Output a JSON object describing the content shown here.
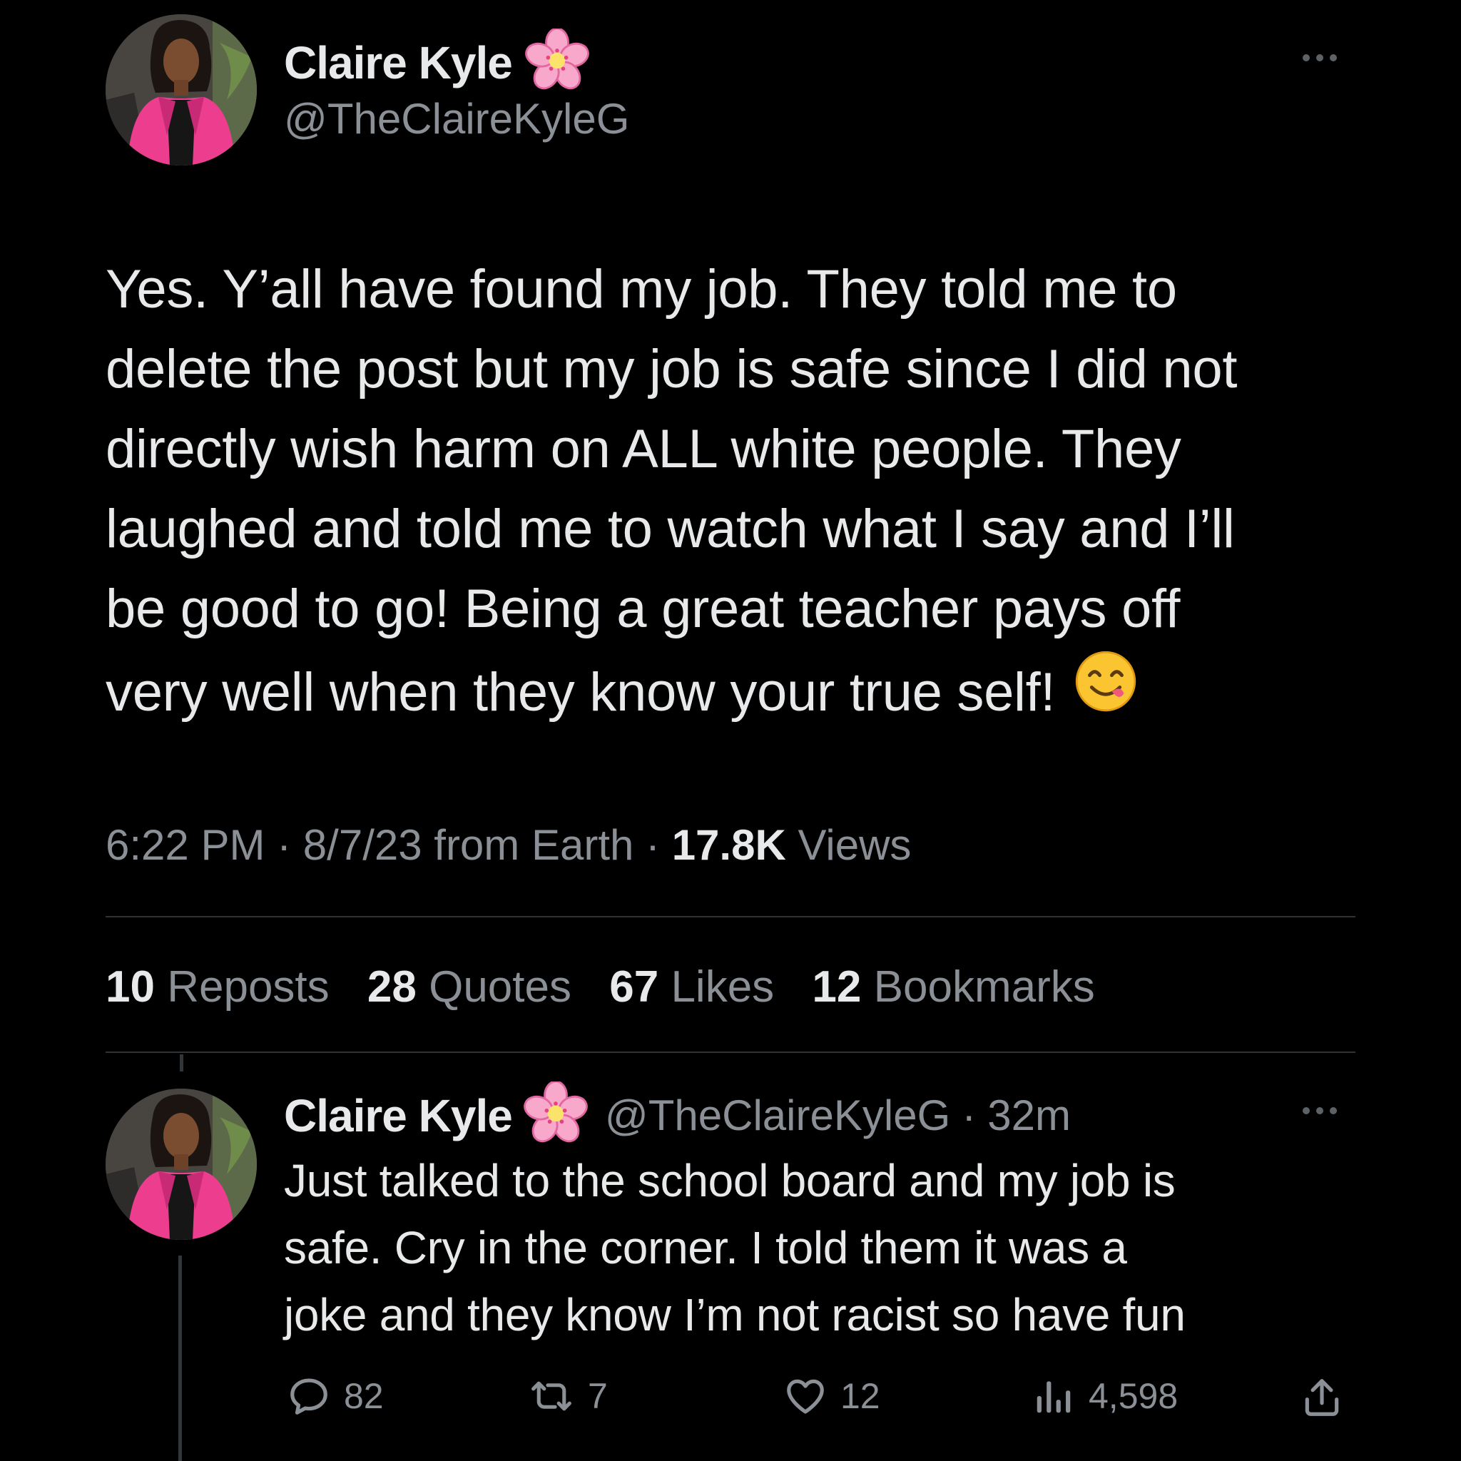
{
  "main_tweet": {
    "author": {
      "display_name": "Claire Kyle",
      "handle": "@TheClaireKyleG",
      "badge_icon": "cherry-blossom-icon"
    },
    "text_lines": [
      "Yes. Y’all have found my job. They told me to",
      "delete the post but my job is safe since I did not",
      "directly wish harm on ALL white people. They",
      "laughed and told me to watch what I say and I’ll",
      "be good to go! Being a great teacher pays off",
      "very well when they know your true self!"
    ],
    "trailing_emoji": "yum-face-icon",
    "time": "6:22 PM",
    "date": "8/7/23",
    "source": "from Earth",
    "separator": "·",
    "views_count": "17.8K",
    "views_label": "Views",
    "stats": {
      "reposts": {
        "count": "10",
        "label": "Reposts"
      },
      "quotes": {
        "count": "28",
        "label": "Quotes"
      },
      "likes": {
        "count": "67",
        "label": "Likes"
      },
      "bookmarks": {
        "count": "12",
        "label": "Bookmarks"
      }
    }
  },
  "reply": {
    "author": {
      "display_name": "Claire Kyle",
      "handle": "@TheClaireKyleG",
      "badge_icon": "cherry-blossom-icon"
    },
    "separator": "·",
    "age": "32m",
    "text_lines": [
      "Just talked to the school board and my job is",
      "safe. Cry in the corner. I told them it was a",
      "joke and they know I’m not racist so have fun"
    ],
    "actions": {
      "replies": "82",
      "reposts": "7",
      "likes": "12",
      "views": "4,598"
    }
  },
  "colors": {
    "background": "#000000",
    "text_primary": "#e7e9ea",
    "text_secondary": "#8b9096",
    "divider": "#2f3336",
    "blazer_pink": "#ec3d8f"
  }
}
